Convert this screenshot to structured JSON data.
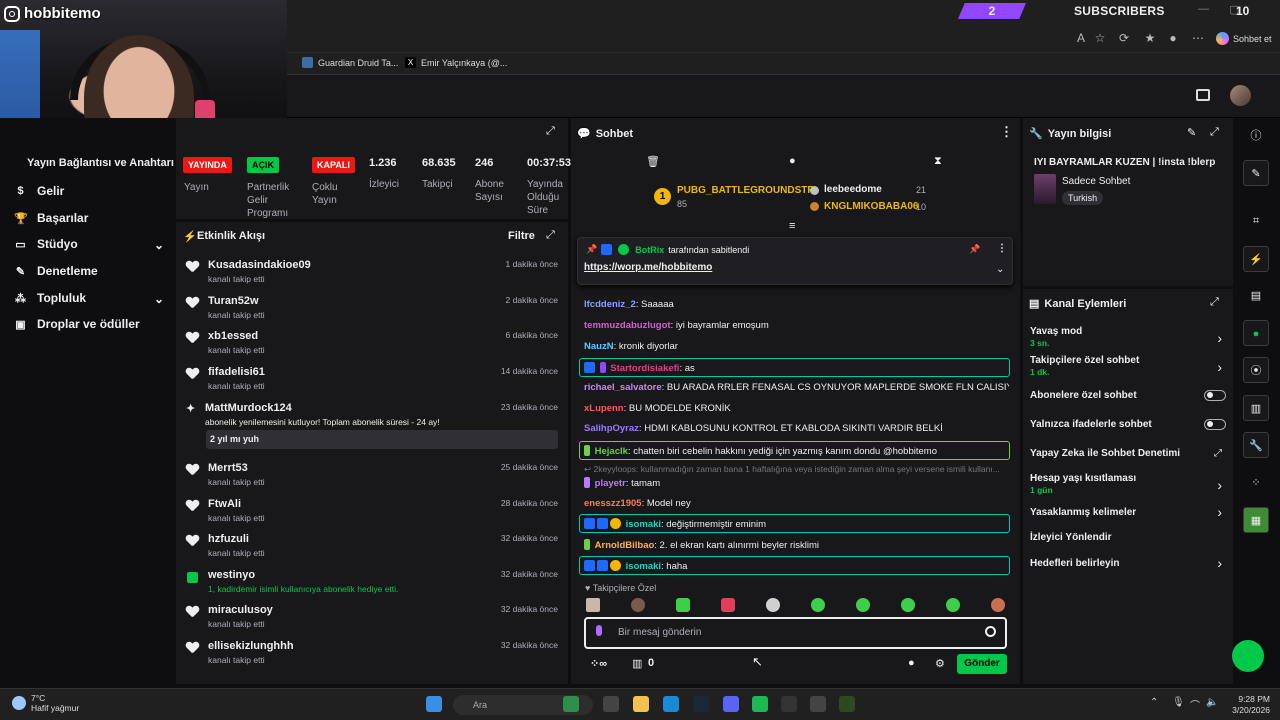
{
  "browser": {
    "subscribers_count": "2",
    "subscribers_label": "SUBSCRIBERS",
    "subscribers_goal": "10",
    "copilot_label": "Sohbet et",
    "bookmarks": [
      {
        "label": "Guardian Druid Ta..."
      },
      {
        "label": "Emir Yalçınkaya (@..."
      }
    ]
  },
  "webcam": {
    "instagram_handle": "hobbitemo"
  },
  "sidebar": {
    "section": "Yayın Bağlantısı ve Anahtarı",
    "items": [
      {
        "label": "Gelir",
        "icon": "money-icon"
      },
      {
        "label": "Başarılar",
        "icon": "trophy-icon"
      },
      {
        "label": "Stüdyo",
        "icon": "studio-icon",
        "expandable": true
      },
      {
        "label": "Denetleme",
        "icon": "wrench-icon"
      },
      {
        "label": "Topluluk",
        "icon": "community-icon",
        "expandable": true
      },
      {
        "label": "Droplar ve ödüller",
        "icon": "drops-icon"
      }
    ]
  },
  "stats": {
    "live_badge": "YAYINDA",
    "live_label": "Yayın",
    "partner_badge": "AÇIK",
    "partner_label": "Partnerlik Gelir Programı",
    "multi_badge": "KAPALI",
    "multi_label": "Çoklu Yayın",
    "viewers_value": "1.236",
    "viewers_label": "İzleyici",
    "followers_value": "68.635",
    "followers_label": "Takipçi",
    "subs_value": "246",
    "subs_label": "Abone Sayısı",
    "uptime_value": "00:37:53",
    "uptime_label": "Yayında Olduğu Süre"
  },
  "feed": {
    "title": "Etkinlik Akışı",
    "filter_label": "Filtre",
    "events": [
      {
        "name": "Kusadasindakioe09",
        "sub": "kanalı takip etti",
        "time": "1 dakika önce",
        "type": "follow"
      },
      {
        "name": "Turan52w",
        "sub": "kanalı takip etti",
        "time": "2 dakika önce",
        "type": "follow"
      },
      {
        "name": "xb1essed",
        "sub": "kanalı takip etti",
        "time": "6 dakika önce",
        "type": "follow"
      },
      {
        "name": "fifadelisi61",
        "sub": "kanalı takip etti",
        "time": "14 dakika önce",
        "type": "follow"
      },
      {
        "name": "MattMurdock124",
        "sub": "abonelik yenilemesini kutluyor! Toplam abonelik süresi - 24 ay!",
        "time": "23 dakika önce",
        "type": "resub",
        "message": "2 yıl mı yuh"
      },
      {
        "name": "Merrt53",
        "sub": "kanalı takip etti",
        "time": "25 dakika önce",
        "type": "follow"
      },
      {
        "name": "FtwAli",
        "sub": "kanalı takip etti",
        "time": "28 dakika önce",
        "type": "follow"
      },
      {
        "name": "hzfuzuli",
        "sub": "kanalı takip etti",
        "time": "32 dakika önce",
        "type": "follow"
      },
      {
        "name": "westinyo",
        "sub": "1, kadirdemir isimli kullanıcıya abonelik hediye etti.",
        "time": "32 dakika önce",
        "type": "gift"
      },
      {
        "name": "miraculusoy",
        "sub": "kanalı takip etti",
        "time": "32 dakika önce",
        "type": "follow"
      },
      {
        "name": "ellisekizlunghhh",
        "sub": "kanalı takip etti",
        "time": "32 dakika önce",
        "type": "follow"
      }
    ]
  },
  "chat": {
    "title": "Sohbet",
    "leaderboard": {
      "first_name": "PUBG_BATTLEGROUNDSTR",
      "first_count": "85",
      "second_name": "leebeedome",
      "second_count": "21",
      "third_name": "KNGLMIKOBABA06",
      "third_count": "10"
    },
    "pinned_by": "BotRix",
    "pinned_suffix": "tarafından sabitlendi",
    "pinned_link": "https://worp.me/hobbitemo",
    "messages": [
      {
        "user": "lfcddeniz_2",
        "text": ": Saaaaa",
        "color": "#8aa0ff"
      },
      {
        "user": "temmuzdabuzlugot",
        "text": ": iyi bayramlar emoşum",
        "color": "#d45fd4"
      },
      {
        "user": "NauzN",
        "text": ": kronik diyorlar",
        "color": "#5ec8ff"
      },
      {
        "user": "Startordisiakefi",
        "text": ": as",
        "color": "#e0408a",
        "boxed": true
      },
      {
        "user": "richael_salvatore",
        "text": ": BU ARADA RRLER FENASAL CS OYNUYOR MAPLERDE SMOKE FLN CALISIYORLAR",
        "color": "#c58af9"
      },
      {
        "user": "xLupenn",
        "text": ": BU MODELDE KRONİK",
        "color": "#ff5a4e"
      },
      {
        "user": "SalihpOyraz",
        "text": ": HDMI KABLOSUNU KONTROL ET KABLODA SIKINTI VARDIR BELKİ",
        "color": "#9a7cff"
      },
      {
        "user": "Hejaclk",
        "text": ": chatten biri cebelin hakkını yediği için yazmış kanım dondu @hobbitemo",
        "color": "#6ad04a",
        "boxed": true,
        "green": true
      },
      {
        "user": "2keyyloops",
        "text": ": kullanmadığın zaman bana 1 haftalığına veya istediğin zaman alma şeyi versene ismili kullanı...",
        "color": "#777777",
        "reply": true
      },
      {
        "user": "playetr",
        "text": ": tamam",
        "color": "#b77cff"
      },
      {
        "user": "enesszz1905",
        "text": ": Model ney",
        "color": "#ff7a59"
      },
      {
        "user": "isomaki",
        "text": ": değiştirmemiştir eminim",
        "color": "#1fd3c2",
        "boxed": true
      },
      {
        "user": "ArnoldBilbao",
        "text": ": 2. el ekran kartı alınırmi beyler risklimi",
        "color": "#ffb347"
      },
      {
        "user": "isomaki",
        "text": ": haha",
        "color": "#1fd3c2",
        "boxed": true
      }
    ],
    "followers_only_label": "Takipçilere Özel",
    "input_placeholder": "Bir mesaj gönderin",
    "points": "0",
    "send_label": "Gönder"
  },
  "stream_info": {
    "title": "Yayın bilgisi",
    "stream_title": "IYI BAYRAMLAR KUZEN | !insta !blerp",
    "category": "Sadece Sohbet",
    "tag": "Turkish"
  },
  "channel_actions": {
    "title": "Kanal Eylemleri",
    "items": [
      {
        "label": "Yavaş mod",
        "sub": "3 sn.",
        "control": "chevron"
      },
      {
        "label": "Takipçilere özel sohbet",
        "sub": "1 dk.",
        "control": "chevron"
      },
      {
        "label": "Abonelere özel sohbet",
        "sub": "",
        "control": "toggle"
      },
      {
        "label": "Yalnızca ifadelerle sohbet",
        "sub": "",
        "control": "toggle"
      },
      {
        "label": "Yapay Zeka ile Sohbet Denetimi",
        "sub": "",
        "control": "external"
      },
      {
        "label": "Hesap yaşı kısıtlaması",
        "sub": "1 gün",
        "control": "chevron"
      },
      {
        "label": "Yasaklanmış kelimeler",
        "sub": "",
        "control": "chevron"
      },
      {
        "label": "İzleyici Yönlendir",
        "sub": "",
        "control": "none"
      },
      {
        "label": "Hedefleri belirleyin",
        "sub": "",
        "control": "chevron"
      }
    ]
  },
  "taskbar": {
    "weather_temp": "7°C",
    "weather_desc": "Hafif yağmur",
    "search_placeholder": "Ara",
    "time": "9:28 PM",
    "date": "3/20/2026"
  },
  "colors": {
    "accent": "#9147ff",
    "send_green": "#00c94a",
    "live_red": "#e91916",
    "partner_green": "#00c94a"
  }
}
